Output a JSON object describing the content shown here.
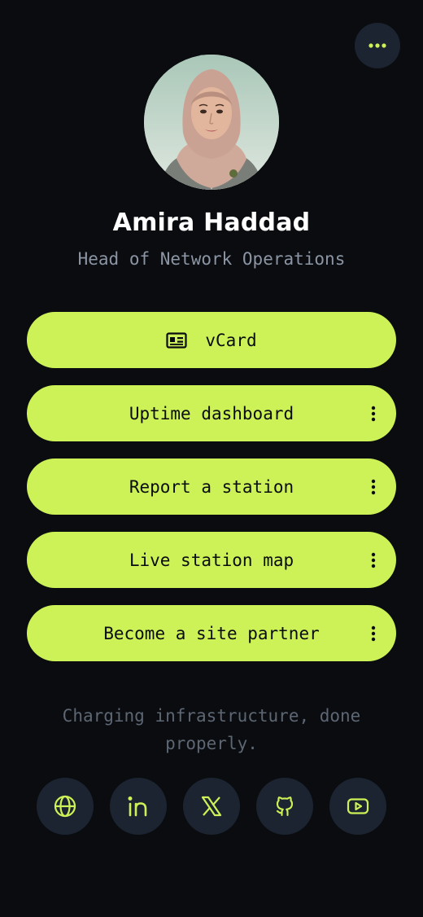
{
  "profile": {
    "name": "Amira Haddad",
    "role": "Head of Network Operations",
    "tagline": "Charging infrastructure, done properly."
  },
  "menu": {
    "icon": "more-horizontal-icon"
  },
  "links": [
    {
      "label": "vCard",
      "icon": "contact-card-icon",
      "has_menu": false
    },
    {
      "label": "Uptime dashboard",
      "has_menu": true
    },
    {
      "label": "Report a station",
      "has_menu": true
    },
    {
      "label": "Live station map",
      "has_menu": true
    },
    {
      "label": "Become a site partner",
      "has_menu": true
    }
  ],
  "socials": [
    {
      "name": "website",
      "icon": "globe-icon"
    },
    {
      "name": "linkedin",
      "icon": "linkedin-icon"
    },
    {
      "name": "x",
      "icon": "x-icon"
    },
    {
      "name": "github",
      "icon": "github-icon"
    },
    {
      "name": "youtube",
      "icon": "youtube-icon"
    }
  ],
  "colors": {
    "background": "#0a0c10",
    "accent": "#cdf257",
    "button_text": "#0a0c10",
    "muted_text": "#8b95a3",
    "chip_bg": "#1b2430"
  }
}
